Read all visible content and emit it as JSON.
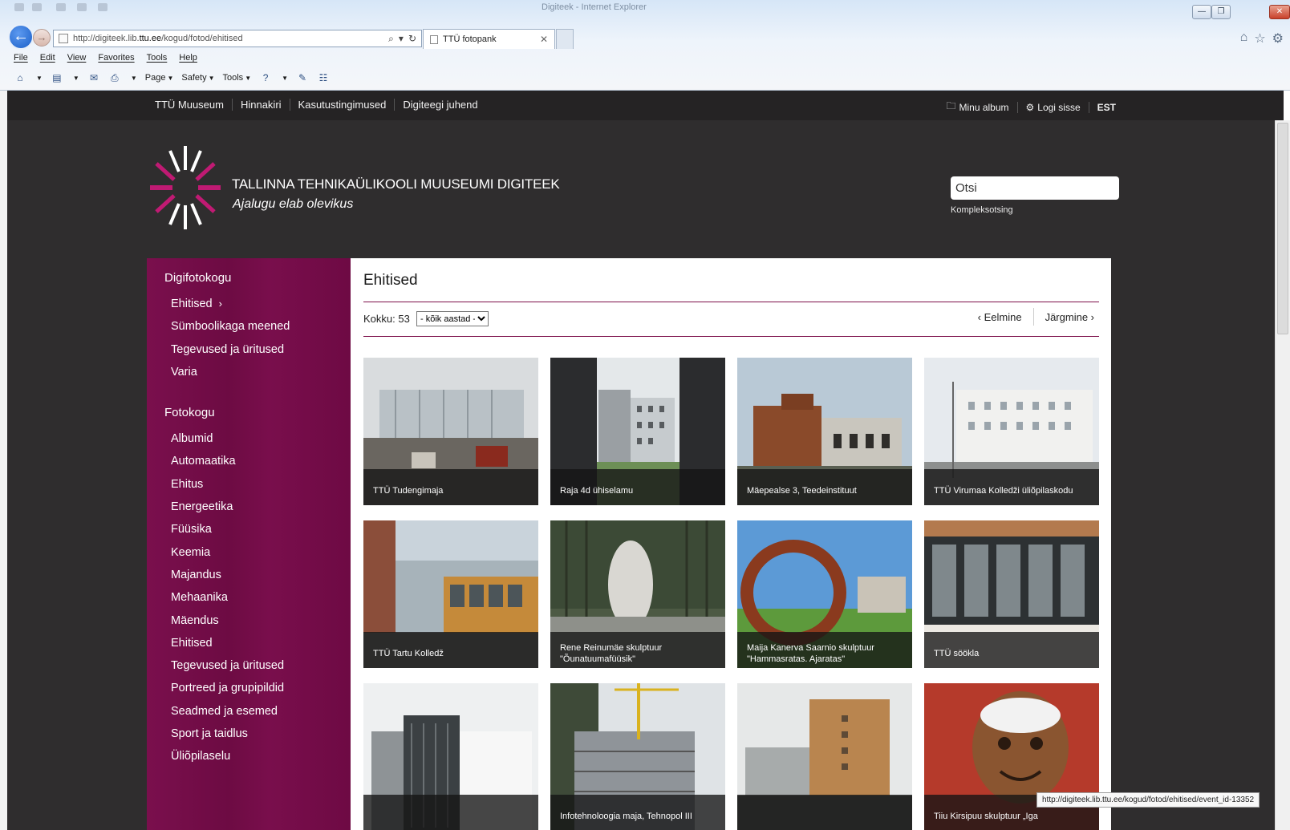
{
  "browser": {
    "window_title": "Digiteek - Internet Explorer",
    "url_prefix": "http://digiteek.lib.",
    "url_domain": "ttu.ee",
    "url_path": "/kogud/fotod/ehitised",
    "tab_label": "TTÜ fotopank",
    "menu": [
      "File",
      "Edit",
      "View",
      "Favorites",
      "Tools",
      "Help"
    ],
    "commands": {
      "page": "Page",
      "safety": "Safety",
      "tools": "Tools"
    }
  },
  "topnav": {
    "links": [
      "TTÜ Muuseum",
      "Hinnakiri",
      "Kasutustingimused",
      "Digiteegi juhend"
    ],
    "album": "Minu album",
    "login": "Logi sisse",
    "lang": "EST"
  },
  "header": {
    "site_name": "TALLINNA TEHNIKAÜLIKOOLI MUUSEUMI DIGITEEK",
    "tagline": "Ajalugu elab olevikus",
    "search_placeholder": "Otsi",
    "adv_search": "Kompleksotsing"
  },
  "sidebar": {
    "section1": {
      "title": "Digifotokogu",
      "items": [
        "Ehitised",
        "Sümboolikaga meened",
        "Tegevused ja üritused",
        "Varia"
      ]
    },
    "section2": {
      "title": "Fotokogu",
      "items": [
        "Albumid",
        "Automaatika",
        "Ehitus",
        "Energeetika",
        "Füüsika",
        "Keemia",
        "Majandus",
        "Mehaanika",
        "Mäendus",
        "Ehitised",
        "Tegevused ja üritused",
        "Portreed ja grupipildid",
        "Seadmed ja esemed",
        "Sport ja taidlus",
        "Üliõpilaselu"
      ]
    }
  },
  "content": {
    "title": "Ehitised",
    "count_label": "Kokku: 53",
    "year_filter": "- kõik aastad -",
    "prev": "‹ Eelmine",
    "next": "Järgmine ›",
    "cards": [
      "TTÜ Tudengimaja",
      "Raja 4d ühiselamu",
      "Mäepealse 3, Teedeinstituut",
      "TTÜ Virumaa Kolledži üliõpilaskodu",
      "TTÜ Tartu Kolledž",
      "Rene Reinumäe skulptuur \"Õunatuumafüüsik\"",
      "Maija Kanerva Saarnio skulptuur \"Hammasratas. Ajaratas\"",
      "TTÜ söökla",
      "",
      "Infotehnoloogia maja, Tehnopol III",
      "",
      "Tiiu Kirsipuu skulptuur „Iga"
    ]
  },
  "status_url": "http://digiteek.lib.ttu.ee/kogud/fotod/ehitised/event_id-13352"
}
